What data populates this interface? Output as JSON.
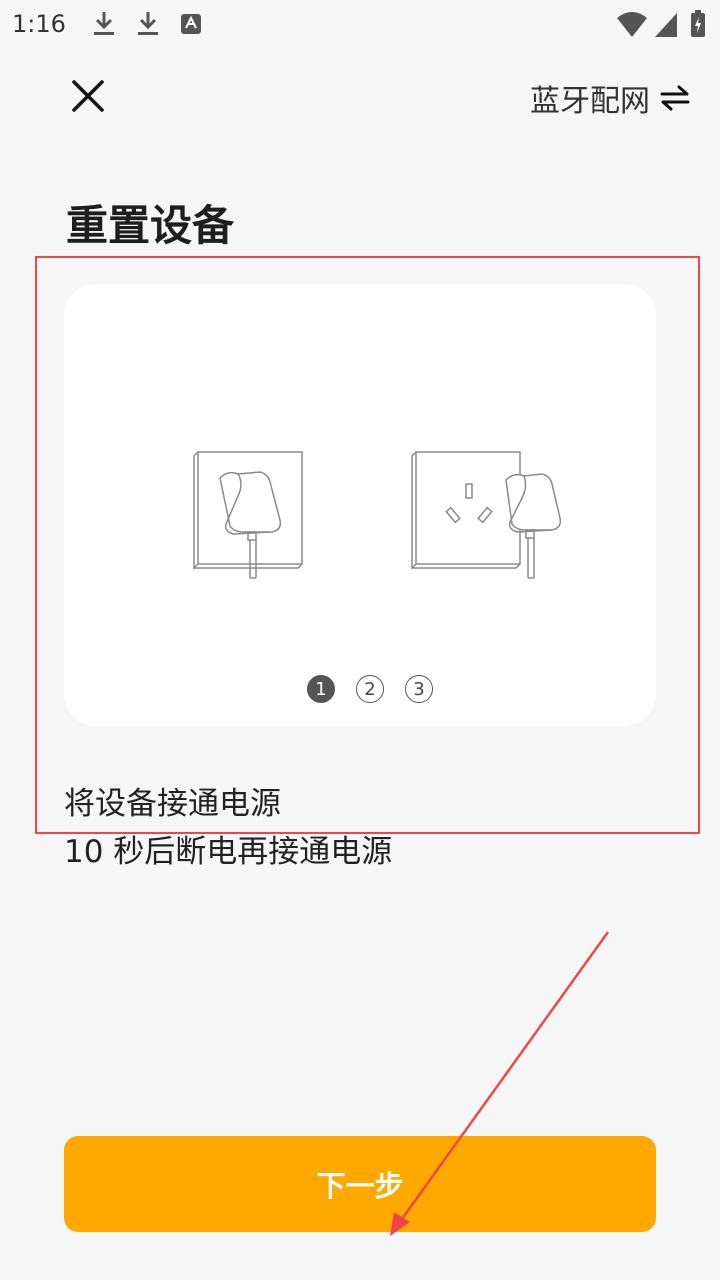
{
  "status_bar": {
    "time": "1:16",
    "left_icons": [
      "download-icon",
      "download-icon",
      "font-notification-icon"
    ],
    "right_icons": [
      "wifi-icon",
      "signal-icon",
      "battery-charging-icon"
    ]
  },
  "header": {
    "close_icon": "close-icon",
    "mode_label": "蓝牙配网",
    "mode_icon": "swap-arrows-icon"
  },
  "title": "重置设备",
  "guide": {
    "illustrations": [
      "socket-plugged-icon",
      "socket-unplugged-icon"
    ],
    "pager": [
      "1",
      "2",
      "3"
    ],
    "active_page": 1
  },
  "instructions": {
    "line1": "将设备接通电源",
    "line2": "10 秒后断电再接通电源"
  },
  "next_button": "下一步",
  "colors": {
    "background": "#f6f6f6",
    "card": "#ffffff",
    "accent": "#ffa800",
    "annotation": "#f0464b"
  }
}
